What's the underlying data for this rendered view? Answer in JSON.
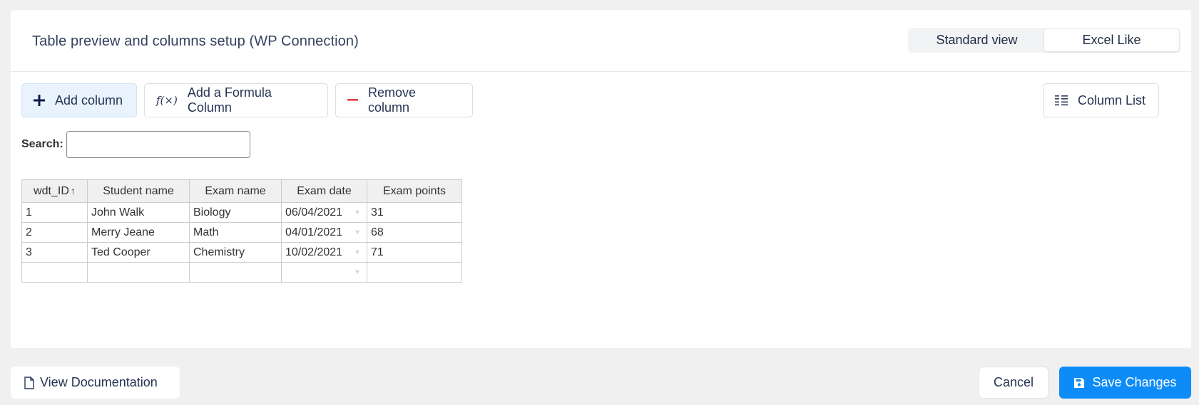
{
  "header": {
    "title": "Table preview and columns setup (WP Connection)",
    "view_options": [
      {
        "label": "Standard view",
        "active": false
      },
      {
        "label": "Excel Like",
        "active": true
      }
    ]
  },
  "toolbar": {
    "add_column": {
      "label": "Add column",
      "icon": "plus-icon"
    },
    "add_formula": {
      "label": "Add a Formula Column",
      "icon": "function-icon",
      "icon_text": "f(×)"
    },
    "remove_column": {
      "label": "Remove column",
      "icon": "minus-icon"
    },
    "column_list": {
      "label": "Column List",
      "icon": "list-icon"
    }
  },
  "search": {
    "label": "Search:",
    "value": "",
    "placeholder": ""
  },
  "table": {
    "columns": [
      {
        "label": "wdt_ID",
        "sort": "↑"
      },
      {
        "label": "Student name"
      },
      {
        "label": "Exam name"
      },
      {
        "label": "Exam date"
      },
      {
        "label": "Exam points"
      }
    ],
    "rows": [
      [
        "1",
        "John Walk",
        "Biology",
        "06/04/2021",
        "31"
      ],
      [
        "2",
        "Merry Jeane",
        "Math",
        "04/01/2021",
        "68"
      ],
      [
        "3",
        "Ted Cooper",
        "Chemistry",
        "10/02/2021",
        "71"
      ],
      [
        "",
        "",
        "",
        "",
        ""
      ]
    ],
    "dropdown_glyph": "▼"
  },
  "footer": {
    "docs": {
      "label": "View Documentation",
      "icon": "document-icon"
    },
    "cancel": {
      "label": "Cancel"
    },
    "save": {
      "label": "Save Changes",
      "icon": "save-icon"
    }
  },
  "colors": {
    "accent": "#0d8cf7",
    "remove_icon": "#e53935",
    "add_bg": "#e9f3fd",
    "page_bg": "#f0f0f1"
  }
}
